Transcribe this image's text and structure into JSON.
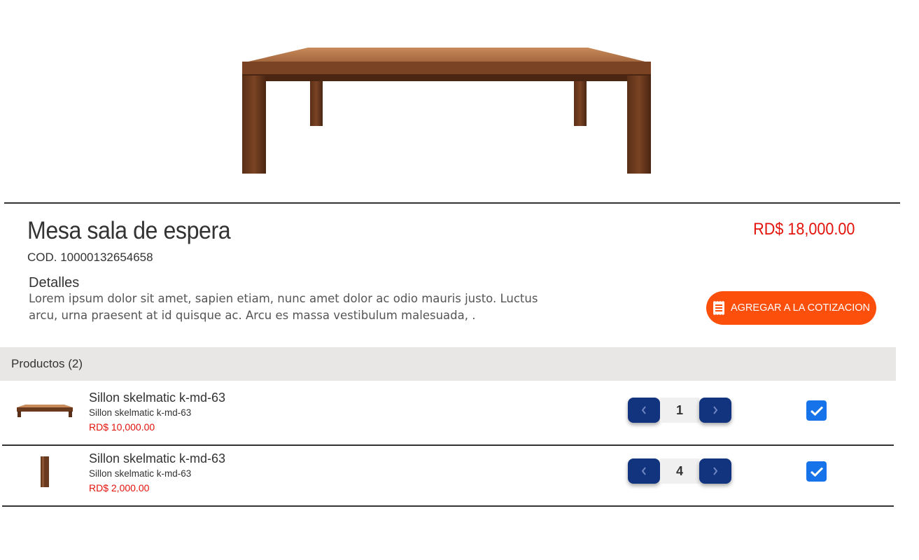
{
  "product": {
    "title": "Mesa sala de espera",
    "code": "COD. 10000132654658",
    "price": "RD$ 18,000.00",
    "details_heading": "Detalles",
    "details_text": "Lorem ipsum dolor sit amet, sapien etiam, nunc amet dolor ac odio mauris justo. Luctus arcu, urna praesent at id quisque ac. Arcu es massa vestibulum malesuada, .",
    "add_button_label": "AGREGAR A LA COTIZACION",
    "add_button_icon": "receipt-icon"
  },
  "products_section": {
    "label": "Productos (2)",
    "items": [
      {
        "name": "Sillon skelmatic k-md-63",
        "subtitle": "Sillon skelmatic k-md-63",
        "price": "RD$ 10,000.00",
        "quantity": "1",
        "checked": true,
        "thumb_icon": "table-thumbnail"
      },
      {
        "name": "Sillon skelmatic k-md-63",
        "subtitle": "Sillon skelmatic k-md-63",
        "price": "RD$ 2,000.00",
        "quantity": "4",
        "checked": true,
        "thumb_icon": "wood-leg-thumbnail"
      }
    ]
  },
  "colors": {
    "accent_orange": "#fb4f0b",
    "stepper_blue": "#12347f",
    "check_blue": "#1673ea",
    "price_red": "#e3120b",
    "section_bar": "#e8e7e5"
  }
}
